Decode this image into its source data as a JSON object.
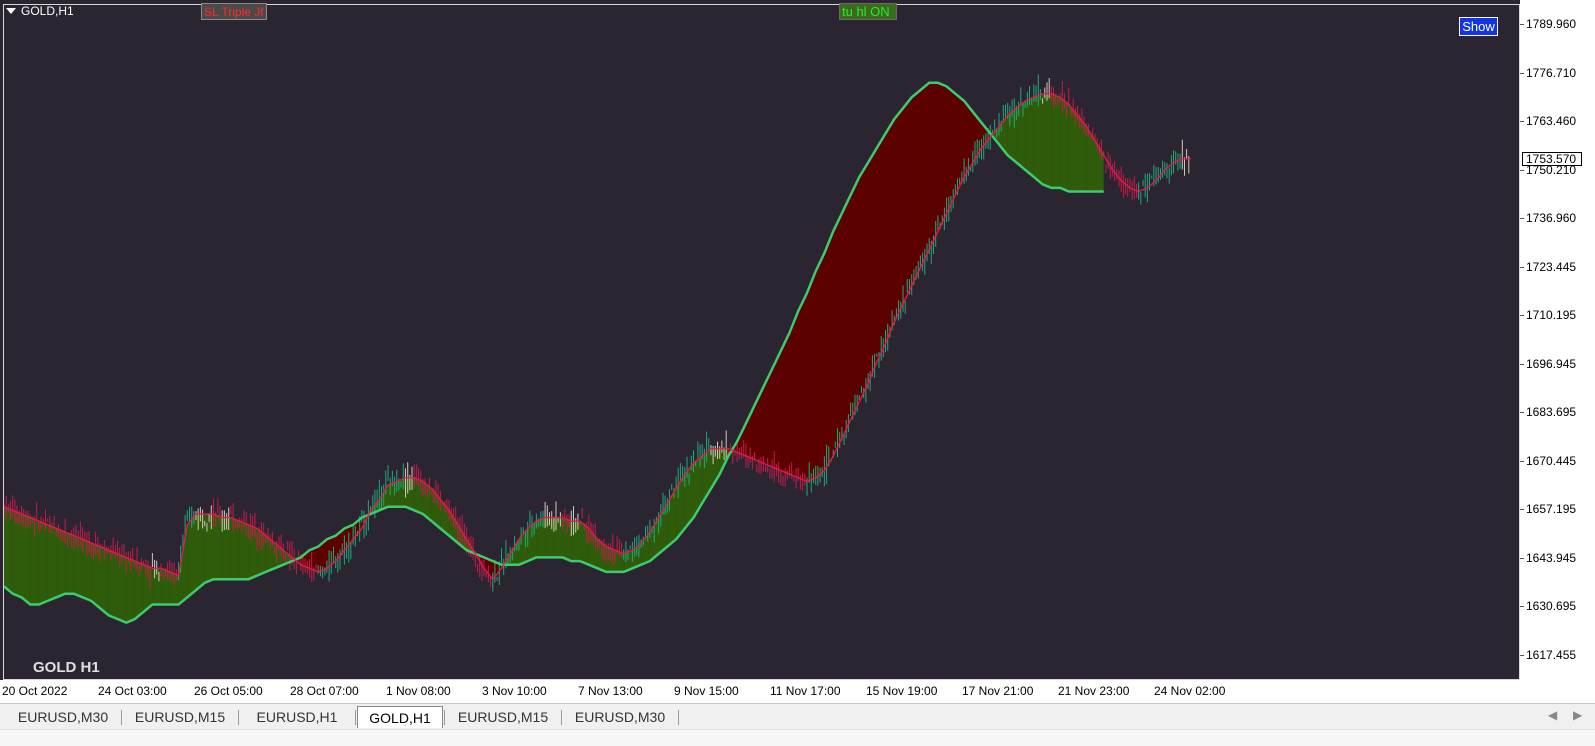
{
  "window": {
    "symbol_label": "GOLD,H1",
    "watermark": "GOLD H1"
  },
  "buttons": {
    "sl_triple": "SL Triple Jf",
    "tu_hl": "tu hl ON",
    "show": "Show"
  },
  "colors": {
    "background": "#2b2532",
    "bull_fill": "#2f5c0b",
    "bear_fill": "#5d0000",
    "fast_line_bull": "#3ccc6e",
    "slow_line_bear": "#e8194f",
    "candle_up": "#1fa87a",
    "candle_down": "#c41b4a",
    "candle_neutral": "#cfc8b8",
    "current_price_box": "#ffffff"
  },
  "price_axis": {
    "ticks": [
      "1789.960",
      "1776.710",
      "1763.460",
      "1750.210",
      "1736.960",
      "1723.445",
      "1710.195",
      "1696.945",
      "1683.695",
      "1670.445",
      "1657.195",
      "1643.945",
      "1630.695",
      "1617.455"
    ],
    "current_price": "1753.570"
  },
  "time_axis": {
    "ticks": [
      "20 Oct 2022",
      "24 Oct 03:00",
      "26 Oct 05:00",
      "28 Oct 07:00",
      "1 Nov 08:00",
      "3 Nov 10:00",
      "7 Nov 13:00",
      "9 Nov 15:00",
      "11 Nov 17:00",
      "15 Nov 19:00",
      "17 Nov 21:00",
      "21 Nov 23:00",
      "24 Nov 02:00"
    ]
  },
  "tabs": [
    {
      "label": "EURUSD,M30",
      "active": false
    },
    {
      "label": "EURUSD,M15",
      "active": false
    },
    {
      "label": "EURUSD,H1",
      "active": false
    },
    {
      "label": "GOLD,H1",
      "active": true
    },
    {
      "label": "EURUSD,M15",
      "active": false
    },
    {
      "label": "EURUSD,M30",
      "active": false
    }
  ],
  "tab_nav": {
    "prev": "◀",
    "next": "▶"
  },
  "chart_data": {
    "type": "line",
    "series": [
      {
        "values": [
          1657,
          1656,
          1655,
          1654,
          1653,
          1652,
          1651,
          1650,
          1649,
          1648,
          1647,
          1646,
          1645,
          1644,
          1643,
          1642,
          1641,
          1640,
          1640,
          1639,
          1638,
          1652,
          1655,
          1655,
          1655,
          1654,
          1654,
          1653,
          1652,
          1651,
          1649,
          1647,
          1645,
          1643,
          1641,
          1640,
          1639,
          1640,
          1642,
          1645,
          1648,
          1651,
          1656,
          1659,
          1663,
          1664,
          1665,
          1665,
          1664,
          1662,
          1659,
          1656,
          1652,
          1648,
          1644,
          1640,
          1637,
          1640,
          1644,
          1648,
          1651,
          1653,
          1654,
          1654,
          1654,
          1653,
          1653,
          1651,
          1648,
          1646,
          1645,
          1644,
          1645,
          1647,
          1650,
          1654,
          1658,
          1662,
          1666,
          1669,
          1671,
          1673,
          1673,
          1673,
          1672,
          1671,
          1670,
          1669,
          1668,
          1667,
          1666,
          1665,
          1664,
          1665,
          1667,
          1671,
          1676,
          1681,
          1686,
          1691,
          1697,
          1702,
          1708,
          1713,
          1718,
          1723,
          1728,
          1733,
          1738,
          1743,
          1748,
          1752,
          1756,
          1759,
          1762,
          1765,
          1767,
          1769,
          1770,
          1771,
          1771,
          1770,
          1768,
          1765,
          1762,
          1758,
          1754,
          1750,
          1747,
          1745,
          1744,
          1745,
          1747,
          1750,
          1752,
          1753,
          1753
        ]
      },
      {
        "values": [
          1635,
          1633,
          1632,
          1630,
          1630,
          1631,
          1632,
          1633,
          1633,
          1632,
          1631,
          1629,
          1627,
          1626,
          1625,
          1626,
          1628,
          1630,
          1630,
          1630,
          1630,
          1632,
          1634,
          1636,
          1637,
          1637,
          1637,
          1637,
          1637,
          1638,
          1639,
          1640,
          1641,
          1642,
          1643,
          1645,
          1646,
          1648,
          1649,
          1651,
          1652,
          1654,
          1655,
          1656,
          1657,
          1657,
          1657,
          1656,
          1655,
          1653,
          1651,
          1649,
          1647,
          1645,
          1644,
          1643,
          1642,
          1641,
          1641,
          1641,
          1642,
          1643,
          1643,
          1643,
          1643,
          1642,
          1642,
          1641,
          1640,
          1639,
          1639,
          1639,
          1640,
          1641,
          1642,
          1644,
          1646,
          1648,
          1651,
          1654,
          1658,
          1662,
          1666,
          1671,
          1675,
          1680,
          1685,
          1690,
          1695,
          1700,
          1705,
          1711,
          1716,
          1722,
          1727,
          1733,
          1738,
          1743,
          1748,
          1752,
          1756,
          1760,
          1764,
          1767,
          1770,
          1772,
          1774,
          1774,
          1773,
          1771,
          1769,
          1766,
          1763,
          1760,
          1757,
          1754,
          1752,
          1750,
          1748,
          1746,
          1745,
          1745,
          1744,
          1744,
          1744,
          1744,
          1744
        ]
      }
    ]
  }
}
